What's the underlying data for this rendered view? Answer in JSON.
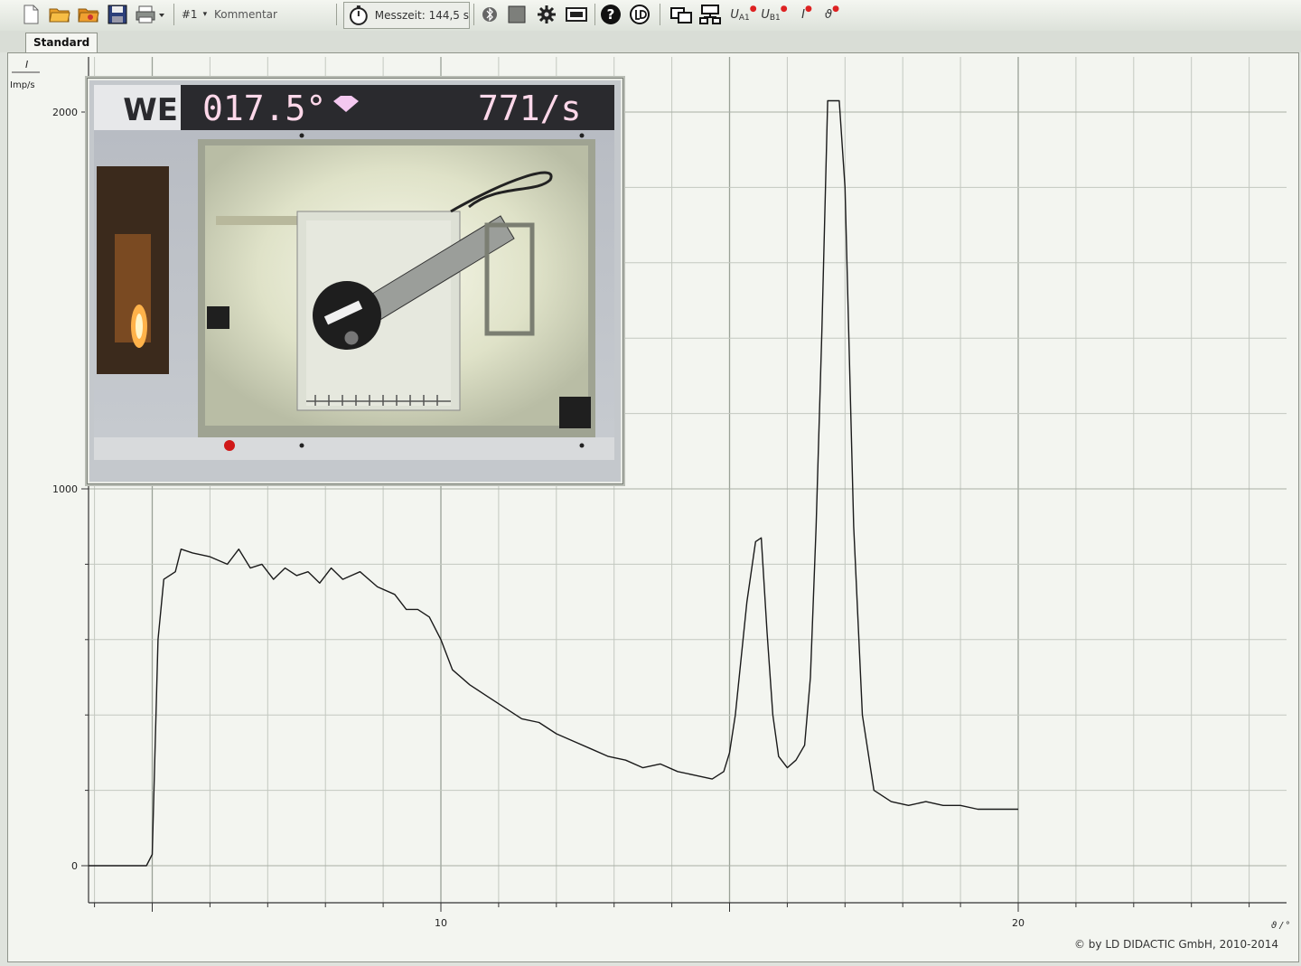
{
  "toolbar": {
    "experiment_label": "#1",
    "comment_label": "Kommentar",
    "measure_time": "Messzeit: 144,5 s",
    "ua1_label": "U",
    "ua1_sub": "A1",
    "ub1_label": "U",
    "ub1_sub": "B1",
    "i_label": "I",
    "theta_label": "ϑ"
  },
  "tab": {
    "label": "Standard"
  },
  "window_controls": {
    "menu": "▾",
    "close": "×"
  },
  "video": {
    "angle_display": "017.5°",
    "rate_display": "771/s",
    "brand_fragment": "WE"
  },
  "footer": {
    "copyright": "© by LD DIDACTIC GmbH, 2010-2014"
  },
  "chart_data": {
    "type": "line",
    "y_axis_symbol": "I",
    "y_axis_unit": "Imp/s",
    "x_axis_label": "ϑ / °",
    "y_ticks": [
      "0",
      "1000",
      "2000"
    ],
    "x_ticks": [
      "10",
      "20"
    ],
    "xlim": [
      3.9,
      24.8
    ],
    "ylim": [
      -100,
      2170
    ],
    "grid": true,
    "series": [
      {
        "points": [
          [
            3.9,
            0
          ],
          [
            4.9,
            0
          ],
          [
            5.0,
            30
          ],
          [
            5.1,
            600
          ],
          [
            5.2,
            760
          ],
          [
            5.4,
            780
          ],
          [
            5.5,
            840
          ],
          [
            5.7,
            830
          ],
          [
            6.0,
            820
          ],
          [
            6.3,
            800
          ],
          [
            6.5,
            840
          ],
          [
            6.7,
            790
          ],
          [
            6.9,
            800
          ],
          [
            7.1,
            760
          ],
          [
            7.3,
            790
          ],
          [
            7.5,
            770
          ],
          [
            7.7,
            780
          ],
          [
            7.9,
            750
          ],
          [
            8.1,
            790
          ],
          [
            8.3,
            760
          ],
          [
            8.6,
            780
          ],
          [
            8.9,
            740
          ],
          [
            9.2,
            720
          ],
          [
            9.4,
            680
          ],
          [
            9.6,
            680
          ],
          [
            9.8,
            660
          ],
          [
            10.0,
            600
          ],
          [
            10.2,
            520
          ],
          [
            10.5,
            480
          ],
          [
            10.8,
            450
          ],
          [
            11.1,
            420
          ],
          [
            11.4,
            390
          ],
          [
            11.7,
            380
          ],
          [
            12.0,
            350
          ],
          [
            12.3,
            330
          ],
          [
            12.6,
            310
          ],
          [
            12.9,
            290
          ],
          [
            13.2,
            280
          ],
          [
            13.5,
            260
          ],
          [
            13.8,
            270
          ],
          [
            14.1,
            250
          ],
          [
            14.4,
            240
          ],
          [
            14.7,
            230
          ],
          [
            14.9,
            250
          ],
          [
            15.0,
            300
          ],
          [
            15.1,
            400
          ],
          [
            15.2,
            550
          ],
          [
            15.3,
            700
          ],
          [
            15.45,
            860
          ],
          [
            15.55,
            870
          ],
          [
            15.65,
            620
          ],
          [
            15.75,
            400
          ],
          [
            15.85,
            290
          ],
          [
            16.0,
            260
          ],
          [
            16.15,
            280
          ],
          [
            16.3,
            320
          ],
          [
            16.4,
            500
          ],
          [
            16.5,
            900
          ],
          [
            16.6,
            1420
          ],
          [
            16.7,
            2030
          ],
          [
            16.9,
            2030
          ],
          [
            17.0,
            1800
          ],
          [
            17.15,
            900
          ],
          [
            17.3,
            400
          ],
          [
            17.5,
            200
          ],
          [
            17.8,
            170
          ],
          [
            18.1,
            160
          ],
          [
            18.4,
            170
          ],
          [
            18.7,
            160
          ],
          [
            19.0,
            160
          ],
          [
            19.3,
            150
          ],
          [
            19.6,
            150
          ],
          [
            20.0,
            150
          ]
        ]
      }
    ]
  }
}
